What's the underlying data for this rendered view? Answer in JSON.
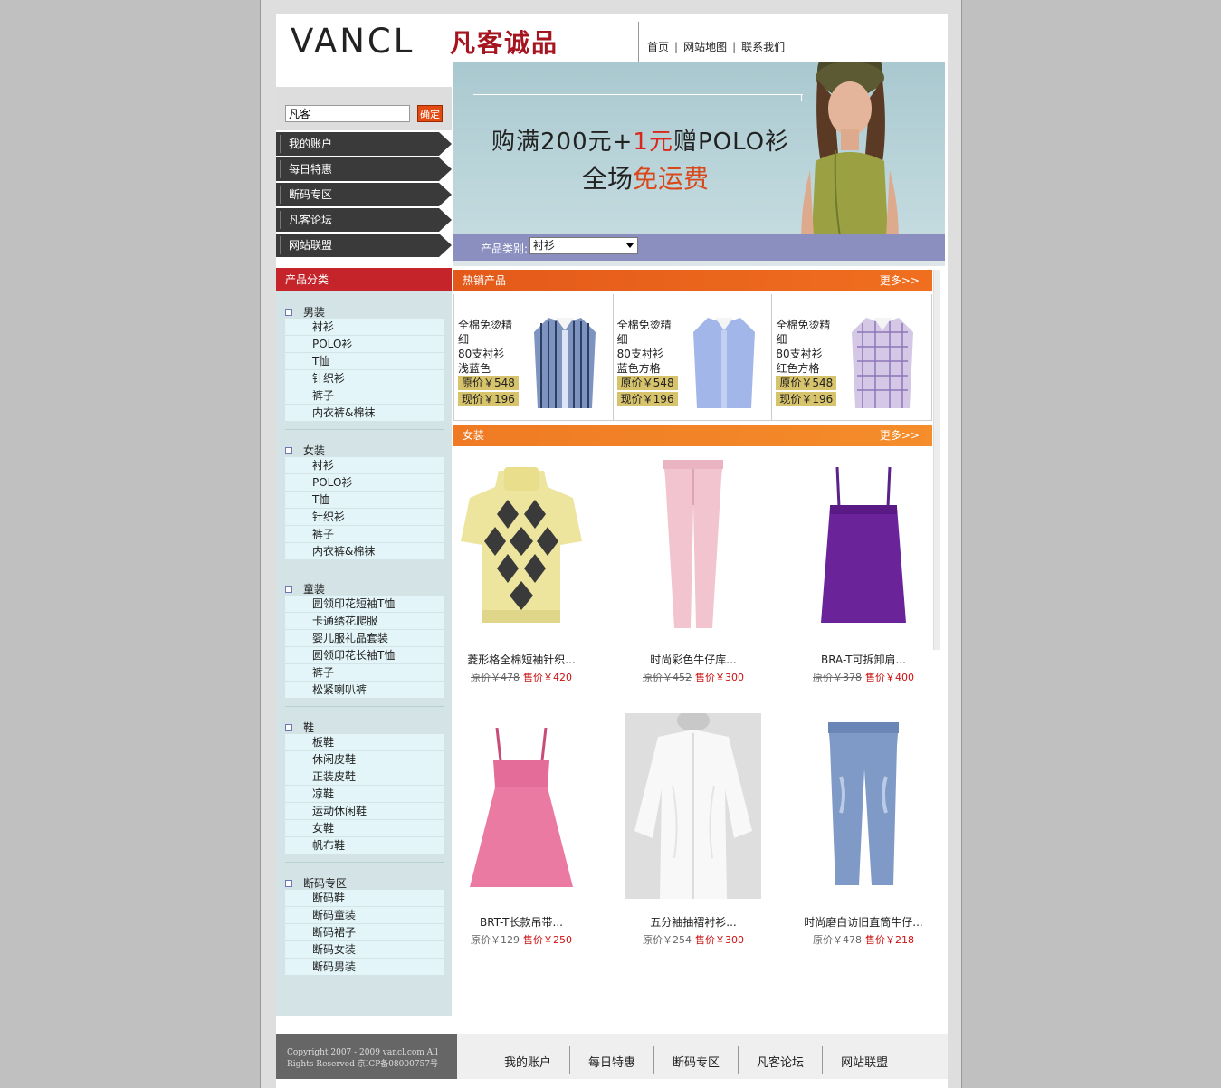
{
  "logo": {
    "en": "VANCL",
    "cn": "凡客诚品"
  },
  "topnav": [
    "首页",
    "网站地图",
    "联系我们"
  ],
  "search": {
    "value": "凡客",
    "button": "确定"
  },
  "menu": [
    "我的账户",
    "每日特惠",
    "断码专区",
    "凡客论坛",
    "网站联盟"
  ],
  "banner": {
    "line1_a": "购满200元+",
    "line1_b": "1元",
    "line1_c": "赠POLO衫",
    "line2_a": "全场",
    "line2_b": "免运费",
    "category_label": "产品类别:",
    "category_value": "衬衫"
  },
  "categories": {
    "head": "产品分类",
    "groups": [
      {
        "title": "男装",
        "items": [
          "衬衫",
          "POLO衫",
          "T恤",
          "针织衫",
          "裤子",
          "内衣裤&棉袜"
        ]
      },
      {
        "title": "女装",
        "items": [
          "衬衫",
          "POLO衫",
          "T恤",
          "针织衫",
          "裤子",
          "内衣裤&棉袜"
        ]
      },
      {
        "title": "童装",
        "items": [
          "圆领印花短袖T恤",
          "卡通绣花爬服",
          "婴儿服礼品套装",
          "圆领印花长袖T恤",
          "裤子",
          "松紧喇叭裤"
        ]
      },
      {
        "title": "鞋",
        "items": [
          "板鞋",
          "休闲皮鞋",
          "正装皮鞋",
          "凉鞋",
          "运动休闲鞋",
          "女鞋",
          "帆布鞋"
        ]
      },
      {
        "title": "断码专区",
        "items": [
          "断码鞋",
          "断码童装",
          "断码裙子",
          "断码女装",
          "断码男装"
        ]
      }
    ]
  },
  "hot": {
    "head": "热销产品",
    "more": "更多>>",
    "items": [
      {
        "t1": "全棉免烫精",
        "t2": "细",
        "t3": "80支衬衫",
        "t4": "浅蓝色",
        "orig": "原价￥548",
        "now": "现价￥196",
        "color": "#7d93c0"
      },
      {
        "t1": "全棉免烫精",
        "t2": "细",
        "t3": "80支衬衫",
        "t4": "蓝色方格",
        "orig": "原价￥548",
        "now": "现价￥196",
        "color": "#9fb3e6"
      },
      {
        "t1": "全棉免烫精",
        "t2": "细",
        "t3": "80支衬衫",
        "t4": "红色方格",
        "orig": "原价￥548",
        "now": "现价￥196",
        "color": "#b9a7d0"
      }
    ]
  },
  "women": {
    "head": "女装",
    "more": "更多>>",
    "items": [
      {
        "name": "菱形格全棉短袖针织...",
        "old": "原价￥478",
        "sale": "售价￥420"
      },
      {
        "name": "时尚彩色牛仔库...",
        "old": "原价￥452",
        "sale": "售价￥300"
      },
      {
        "name": "BRA-T可拆卸肩...",
        "old": "原价￥378",
        "sale": "售价￥400"
      },
      {
        "name": "BRT-T长款吊带...",
        "old": "原价￥129",
        "sale": "售价￥250"
      },
      {
        "name": "五分袖抽褶衬衫...",
        "old": "原价￥254",
        "sale": "售价￥300"
      },
      {
        "name": "时尚磨白访旧直筒牛仔...",
        "old": "原价￥478",
        "sale": "售价￥218"
      }
    ]
  },
  "footer": {
    "copyright1": "Copyright 2007 - 2009 vancl.com All",
    "copyright2": "Rights Reserved 京ICP备08000757号",
    "nav": [
      "我的账户",
      "每日特惠",
      "断码专区",
      "凡客论坛",
      "网站联盟"
    ]
  }
}
